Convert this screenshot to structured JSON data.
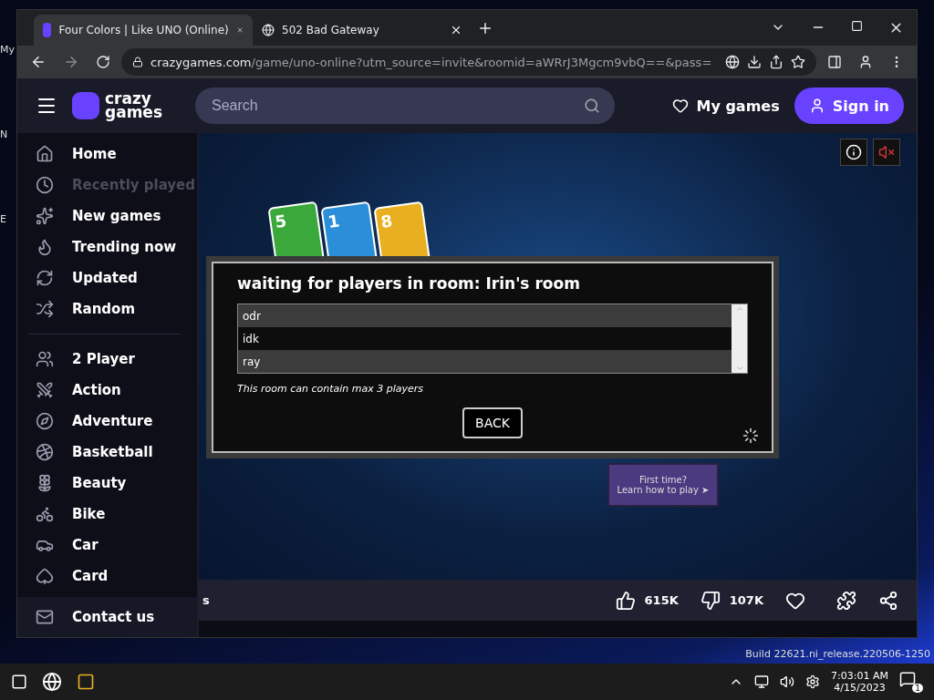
{
  "desktop": {
    "labels": [
      "My",
      "N",
      "E"
    ],
    "watermark": "Build 22621.ni_release.220506-1250"
  },
  "browser": {
    "tabs": [
      {
        "title": "Four Colors | Like UNO (Online)",
        "selected": true
      },
      {
        "title": "502 Bad Gateway",
        "selected": false
      }
    ],
    "address": {
      "host": "crazygames.com",
      "path": "/game/uno-online?utm_source=invite&roomid=aWRrJ3Mgcm9vbQ==&pass="
    }
  },
  "header": {
    "logo_top": "crazy",
    "logo_bottom": "games",
    "search": {
      "placeholder": "Search"
    },
    "my_games": "My games",
    "sign_in": "Sign in"
  },
  "sidebar": {
    "groups": [
      [
        {
          "label": "Home",
          "disabled": false
        },
        {
          "label": "Recently played",
          "disabled": true
        },
        {
          "label": "New games",
          "disabled": false
        },
        {
          "label": "Trending now",
          "disabled": false
        },
        {
          "label": "Updated",
          "disabled": false
        },
        {
          "label": "Random",
          "disabled": false
        }
      ],
      [
        {
          "label": "2 Player",
          "disabled": false
        },
        {
          "label": "Action",
          "disabled": false
        },
        {
          "label": "Adventure",
          "disabled": false
        },
        {
          "label": "Basketball",
          "disabled": false
        },
        {
          "label": "Beauty",
          "disabled": false
        },
        {
          "label": "Bike",
          "disabled": false
        },
        {
          "label": "Car",
          "disabled": false
        },
        {
          "label": "Card",
          "disabled": false
        }
      ]
    ],
    "footer": "Contact us"
  },
  "game": {
    "cards": [
      "5",
      "1",
      "8"
    ],
    "dialog": {
      "title": "waiting for players in room: Irin's room",
      "players": [
        "odr",
        "idk",
        "ray"
      ],
      "note": "This room can contain max 3 players",
      "button": "BACK"
    },
    "help": {
      "line1": "First time?",
      "line2": "Learn how to play ➤"
    }
  },
  "game_bar": {
    "title_fragment": "s",
    "likes": "615K",
    "dislikes": "107K"
  },
  "taskbar": {
    "time": "7:03:01 AM",
    "date": "4/15/2023",
    "notifications": "1"
  }
}
